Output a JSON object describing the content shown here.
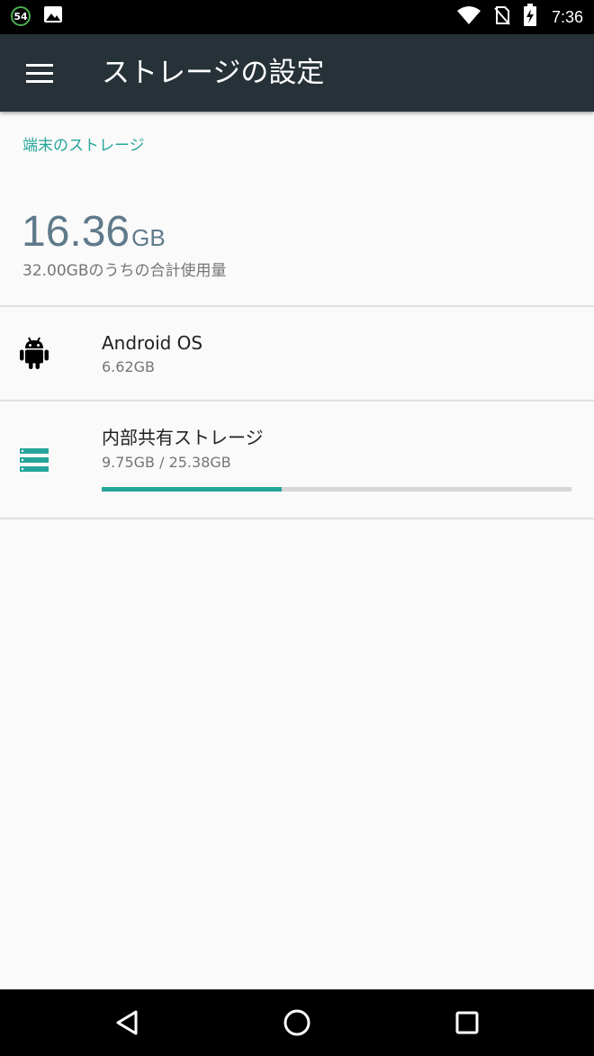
{
  "status_bar": {
    "notification_count": "54",
    "time": "7:36"
  },
  "app_bar": {
    "title": "ストレージの設定"
  },
  "device_storage": {
    "section_header": "端末のストレージ",
    "used_number": "16.36",
    "used_unit": "GB",
    "used_caption": "32.00GBのうちの合計使用量"
  },
  "items": [
    {
      "title": "Android OS",
      "subtitle": "6.62GB",
      "icon": "android-icon"
    },
    {
      "title": "内部共有ストレージ",
      "subtitle": "9.75GB / 25.38GB",
      "icon": "storage-icon",
      "usage_fraction": 0.384
    }
  ],
  "colors": {
    "accent": "#26a69a",
    "app_bar": "#263238",
    "used_amount": "#5f7a8a"
  }
}
